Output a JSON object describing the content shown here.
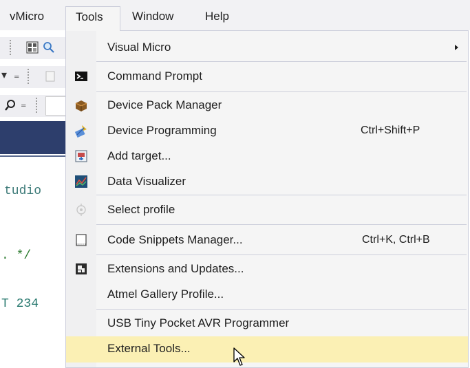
{
  "menubar": {
    "items": [
      {
        "label": "vMicro"
      },
      {
        "label": "Tools"
      },
      {
        "label": "Window"
      },
      {
        "label": "Help"
      }
    ]
  },
  "background": {
    "code_lines": [
      "tudio",
      ". */",
      "T 234"
    ]
  },
  "tools_menu": {
    "items": [
      {
        "label": "Visual Micro",
        "shortcut": "",
        "icon": "none",
        "submenu": true
      },
      {
        "label": "Command Prompt",
        "shortcut": "",
        "icon": "command-prompt-icon"
      },
      {
        "label": "Device Pack Manager",
        "shortcut": "",
        "icon": "device-pack-icon"
      },
      {
        "label": "Device Programming",
        "shortcut": "Ctrl+Shift+P",
        "icon": "device-programming-icon"
      },
      {
        "label": "Add target...",
        "shortcut": "",
        "icon": "add-target-icon"
      },
      {
        "label": "Data Visualizer",
        "shortcut": "",
        "icon": "data-visualizer-icon"
      },
      {
        "label": "Select profile",
        "shortcut": "",
        "icon": "select-profile-icon"
      },
      {
        "label": "Code Snippets Manager...",
        "shortcut": "Ctrl+K, Ctrl+B",
        "icon": "code-snippets-icon"
      },
      {
        "label": "Extensions and Updates...",
        "shortcut": "",
        "icon": "extensions-icon"
      },
      {
        "label": "Atmel Gallery Profile...",
        "shortcut": "",
        "icon": "none"
      },
      {
        "label": "USB Tiny Pocket AVR Programmer",
        "shortcut": "",
        "icon": "none"
      },
      {
        "label": "External Tools...",
        "shortcut": "",
        "icon": "none",
        "highlighted": true
      }
    ]
  },
  "colors": {
    "highlight": "#fbf0b4",
    "menu_bg": "#f5f5f5",
    "border": "#cccedb",
    "ide_blue": "#2d3e6c"
  }
}
